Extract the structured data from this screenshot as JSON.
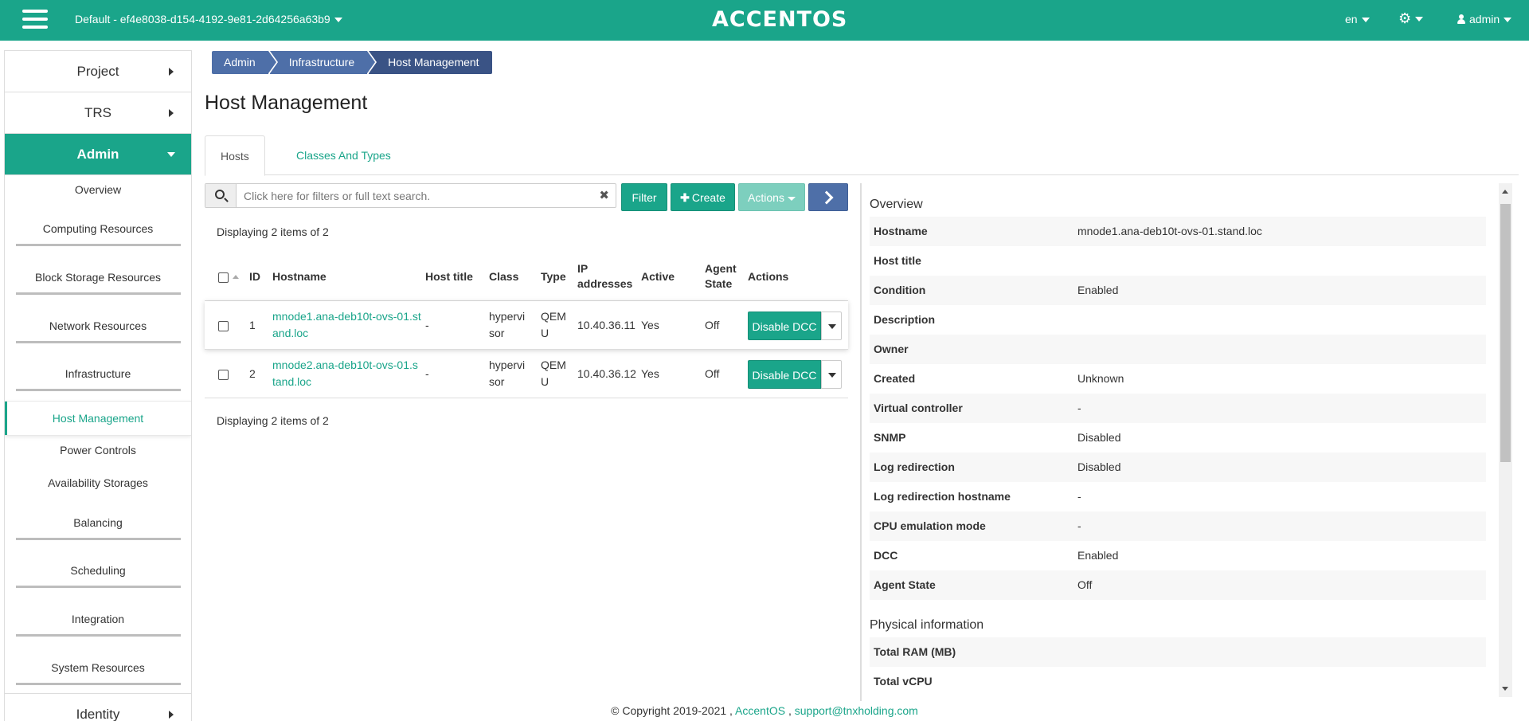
{
  "topbar": {
    "project": "Default - ef4e8038-d154-4192-9e81-2d64256a63b9",
    "brand": "ACCENTOS",
    "language": "en",
    "user": "admin"
  },
  "sidebar": {
    "sections": {
      "project": "Project",
      "trs": "TRS",
      "admin": "Admin",
      "identity": "Identity"
    },
    "items": [
      "Overview",
      "Computing Resources",
      "Block Storage Resources",
      "Network Resources",
      "Infrastructure",
      "Host Management",
      "Power Controls",
      "Availability Storages",
      "Balancing",
      "Scheduling",
      "Integration",
      "System Resources"
    ]
  },
  "breadcrumb": [
    "Admin",
    "Infrastructure",
    "Host Management"
  ],
  "page_title": "Host Management",
  "tabs": [
    "Hosts",
    "Classes And Types"
  ],
  "toolbar": {
    "search_placeholder": "Click here for filters or full text search.",
    "clear_symbol": "✖",
    "filter_label": "Filter",
    "create_label": "Create",
    "create_symbol": "✚",
    "actions_label": "Actions"
  },
  "table": {
    "display_count_top": "Displaying 2 items of 2",
    "display_count_bottom": "Displaying 2 items of 2",
    "headers": {
      "id": "ID",
      "hostname": "Hostname",
      "host_title": "Host title",
      "class": "Class",
      "type": "Type",
      "ip_line1": "IP",
      "ip_line2": "addresses",
      "active": "Active",
      "agent_line1": "Agent",
      "agent_line2": "State",
      "actions": "Actions"
    },
    "rows": [
      {
        "id": "1",
        "hostname_line1": "mnode1.ana-deb10t-ovs-01.st",
        "hostname_line2": "and.loc",
        "host_title": "-",
        "class_line1": "hypervi",
        "class_line2": "sor",
        "type_line1": "QEM",
        "type_line2": "U",
        "ip": "10.40.36.11",
        "active": "Yes",
        "agent_state": "Off",
        "action": "Disable DCC"
      },
      {
        "id": "2",
        "hostname_line1": "mnode2.ana-deb10t-ovs-01.s",
        "hostname_line2": "tand.loc",
        "host_title": "-",
        "class_line1": "hypervi",
        "class_line2": "sor",
        "type_line1": "QEM",
        "type_line2": "U",
        "ip": "10.40.36.12",
        "active": "Yes",
        "agent_state": "Off",
        "action": "Disable DCC"
      }
    ]
  },
  "details": {
    "overview_title": "Overview",
    "overview": [
      {
        "label": "Hostname",
        "value": "mnode1.ana-deb10t-ovs-01.stand.loc"
      },
      {
        "label": "Host title",
        "value": ""
      },
      {
        "label": "Condition",
        "value": "Enabled"
      },
      {
        "label": "Description",
        "value": ""
      },
      {
        "label": "Owner",
        "value": ""
      },
      {
        "label": "Created",
        "value": "Unknown"
      },
      {
        "label": "Virtual controller",
        "value": "-"
      },
      {
        "label": "SNMP",
        "value": "Disabled"
      },
      {
        "label": "Log redirection",
        "value": "Disabled"
      },
      {
        "label": "Log redirection hostname",
        "value": "-"
      },
      {
        "label": "CPU emulation mode",
        "value": "-"
      },
      {
        "label": "DCC",
        "value": "Enabled"
      },
      {
        "label": "Agent State",
        "value": "Off"
      }
    ],
    "physical_title": "Physical information",
    "physical": [
      {
        "label": "Total RAM (MB)",
        "value": ""
      },
      {
        "label": "Total vCPU",
        "value": ""
      }
    ]
  },
  "footer": {
    "copyright": "© Copyright 2019-2021 ,",
    "brand_link": "AccentOS",
    "separator": ",",
    "support_link": "support@tnxholding.com"
  }
}
